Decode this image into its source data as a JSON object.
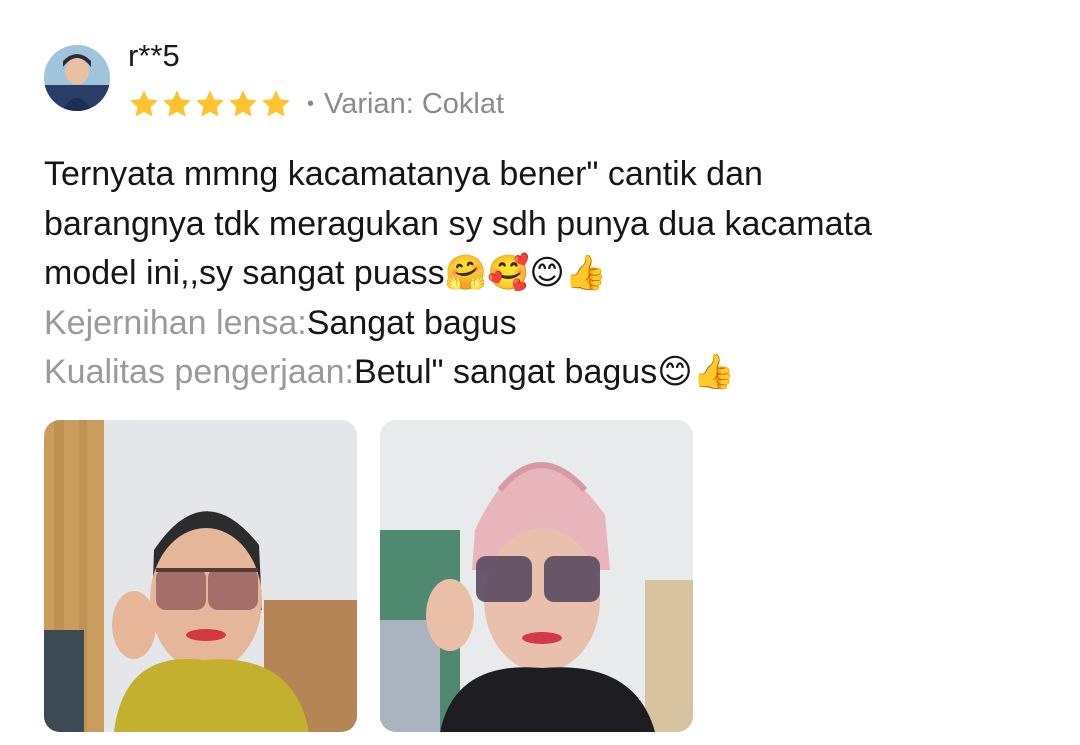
{
  "review": {
    "username": "r**5",
    "rating": 5,
    "variant_label": "Varian:",
    "variant_value": "Coklat",
    "text_line_1": "Ternyata mmng kacamatanya bener\" cantik dan",
    "text_line_2": "barangnya tdk meragukan sy sdh punya dua kacamata",
    "text_line_3": "model ini,,sy sangat puass",
    "text_line_3_emoji": "🤗🥰😊👍",
    "attributes": [
      {
        "label": "Kejernihan lensa:",
        "value": "Sangat bagus",
        "emoji": ""
      },
      {
        "label": "Kualitas pengerjaan:",
        "value": "Betul\" sangat bagus",
        "emoji": "😊👍"
      }
    ]
  },
  "icons": {
    "star": "star-icon",
    "star_color": "#fdc42e"
  },
  "photos": [
    {
      "name": "review-photo-1"
    },
    {
      "name": "review-photo-2"
    }
  ]
}
